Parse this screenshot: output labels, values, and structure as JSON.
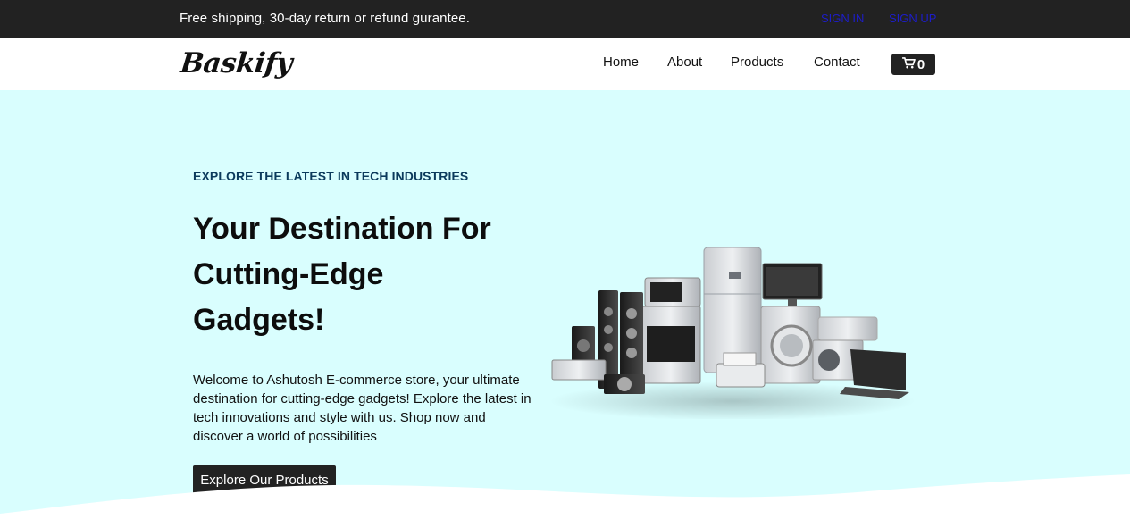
{
  "topbar": {
    "promo": "Free shipping, 30-day return or refund gurantee.",
    "sign_in": "SIGN IN",
    "sign_up": "SIGN UP"
  },
  "navbar": {
    "logo": "Baskify",
    "links": [
      "Home",
      "About",
      "Products",
      "Contact"
    ],
    "cart_count": "0",
    "cart_icon": "cart-icon"
  },
  "hero": {
    "eyebrow": "EXPLORE THE LATEST IN TECH INDUSTRIES",
    "headline_lines": [
      "Your Destination For",
      "Cutting-Edge",
      "Gadgets!"
    ],
    "description": "Welcome to Ashutosh E-commerce store, your ultimate destination for cutting-edge gadgets! Explore the latest in tech innovations and style with us. Shop now and discover a world of possibilities",
    "cta": "Explore Our Products",
    "image": "electronics-appliances-illustration"
  },
  "colors": {
    "topbar_bg": "#222222",
    "hero_bg": "#d9fefe",
    "auth_link": "#1d1dc9",
    "eyebrow": "#0b3a5c"
  }
}
